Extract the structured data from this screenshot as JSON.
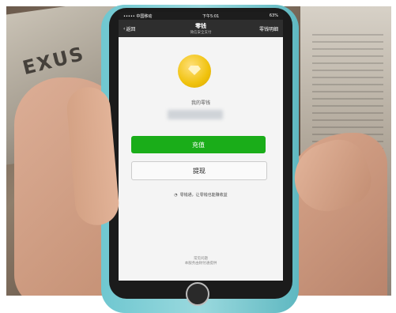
{
  "background": {
    "sign_text": "EXUS"
  },
  "status_bar": {
    "carrier": "••••• 中国移动",
    "time": "下午5:01",
    "battery": "63%"
  },
  "nav": {
    "back_label": "返回",
    "title": "零钱",
    "subtitle": "微信安全支付",
    "right_label": "零钱明细"
  },
  "wallet": {
    "balance_label": "我的零钱",
    "recharge_label": "充值",
    "withdraw_label": "提现",
    "notice_text": "零钱通，让零钱也能赚收益",
    "footer_line1": "常见问题",
    "footer_line2": "本服务由财付通提供"
  },
  "colors": {
    "accent": "#1aad19",
    "coin": "#f0c20d",
    "navbar": "#2e2e2e"
  }
}
